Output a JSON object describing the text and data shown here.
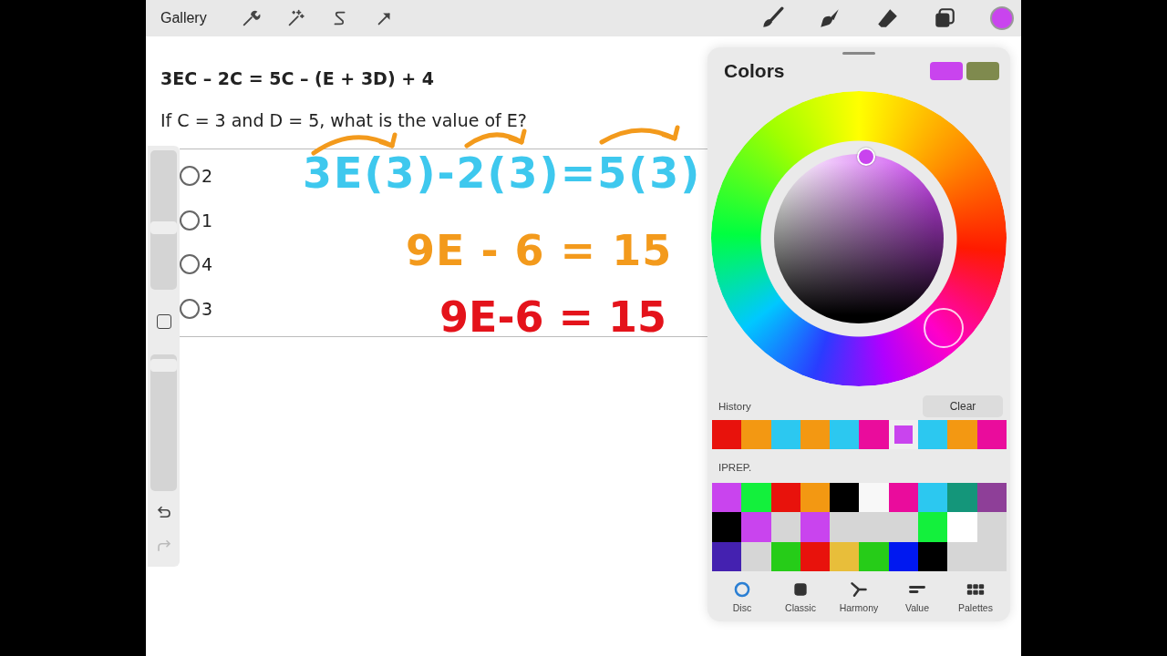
{
  "toolbar": {
    "gallery": "Gallery"
  },
  "sidebar": {
    "size_slider": {
      "level": 0.44
    },
    "opacity_slider": {
      "level": 0.96
    }
  },
  "question": {
    "formula": "3EC – 2C = 5C – (E + 3D) + 4",
    "prompt": "If C = 3 and D = 5, what is the value of E?",
    "options": [
      {
        "label": "2",
        "selected": false
      },
      {
        "label": "1",
        "selected": false
      },
      {
        "label": "4",
        "selected": false
      },
      {
        "label": "3",
        "selected": false
      }
    ]
  },
  "handwriting": [
    {
      "text": "3E(3)-2(3)=5(3)",
      "color": "#3ec8ee"
    },
    {
      "text": "9E - 6 = 15",
      "color": "#f39a1c"
    },
    {
      "text": "9E-6 = 15",
      "color": "#e4131b"
    }
  ],
  "colors_panel": {
    "title": "Colors",
    "history_label": "History",
    "clear_button": "Clear",
    "history": [
      {
        "color": "#e8120c",
        "selected": false
      },
      {
        "color": "#f39812",
        "selected": false
      },
      {
        "color": "#2cc8f0",
        "selected": false
      },
      {
        "color": "#f39812",
        "selected": false
      },
      {
        "color": "#2cc8f0",
        "selected": false
      },
      {
        "color": "#ea0c9c",
        "selected": false
      },
      {
        "color": "#c944ee",
        "selected": true
      },
      {
        "color": "#2cc8f0",
        "selected": false
      },
      {
        "color": "#f39812",
        "selected": false
      },
      {
        "color": "#ea0c9c",
        "selected": false
      }
    ],
    "palette_name": "IPREP.",
    "palette": [
      {
        "color": "#c944ee"
      },
      {
        "color": "#13f03c"
      },
      {
        "color": "#e8120c"
      },
      {
        "color": "#f39812"
      },
      {
        "color": "#000000"
      },
      {
        "color": "#f8f8f8"
      },
      {
        "color": "#ea0c9c"
      },
      {
        "color": "#2cc8f0"
      },
      {
        "color": "#14967a"
      },
      {
        "color": "#8e3f98"
      },
      {
        "color": "#000000"
      },
      {
        "color": "#c944ee"
      },
      {
        "color": "#d6d6d6"
      },
      {
        "color": "#c944ee"
      },
      {
        "color": "#d6d6d6"
      },
      {
        "color": "#d6d6d6"
      },
      {
        "color": "#d6d6d6"
      },
      {
        "color": "#13f03c"
      },
      {
        "color": "#ffffff"
      },
      {
        "color": "#d6d6d6"
      },
      {
        "color": "#4421b0"
      },
      {
        "color": "#d6d6d6"
      },
      {
        "color": "#26cc18"
      },
      {
        "color": "#e8120c"
      },
      {
        "color": "#e8be3a"
      },
      {
        "color": "#26cc18"
      },
      {
        "color": "#0018f0"
      },
      {
        "color": "#000000"
      },
      {
        "color": "#d6d6d6"
      },
      {
        "color": "#d6d6d6"
      }
    ],
    "tabs": [
      {
        "kind": "disc",
        "label": "Disc",
        "selected": true
      },
      {
        "kind": "classic",
        "label": "Classic",
        "selected": false
      },
      {
        "kind": "harmony",
        "label": "Harmony",
        "selected": false
      },
      {
        "kind": "value",
        "label": "Value",
        "selected": false
      },
      {
        "kind": "palettes",
        "label": "Palettes",
        "selected": false
      }
    ]
  }
}
